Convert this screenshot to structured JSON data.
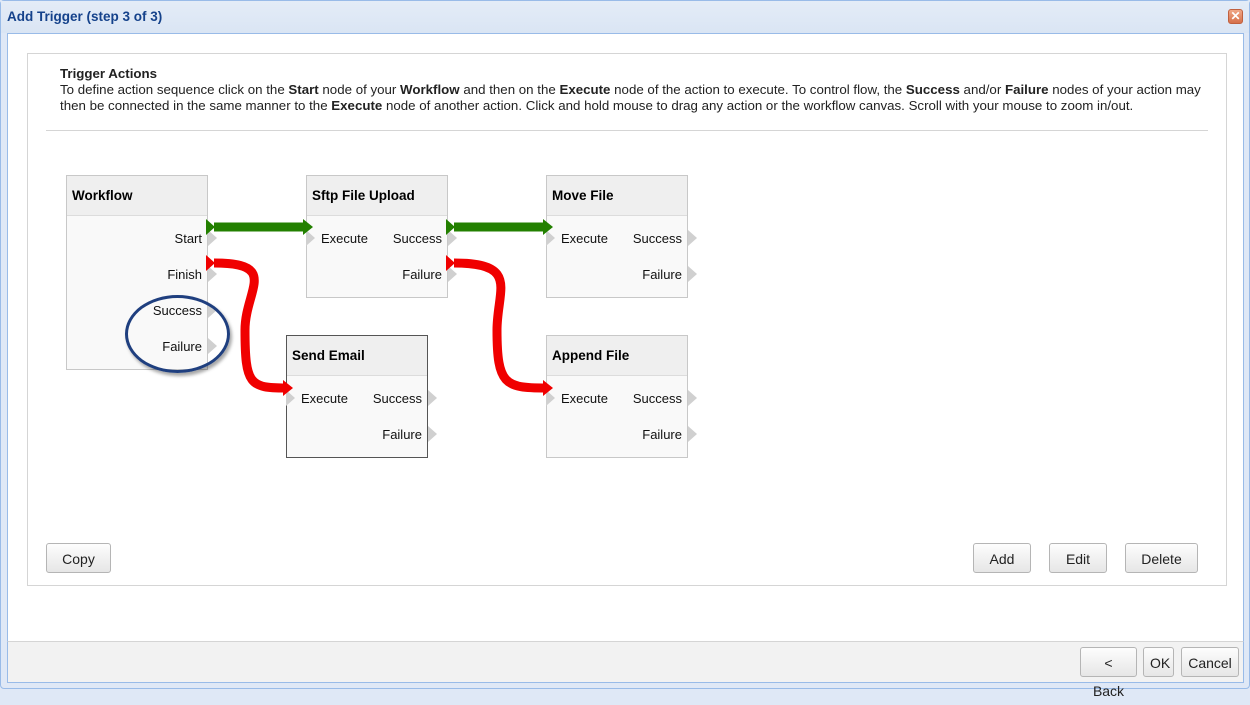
{
  "window": {
    "title": "Add Trigger (step 3 of 3)",
    "close_icon": "close-icon",
    "close_glyph": "✕"
  },
  "instructions": {
    "title": "Trigger Actions",
    "segments": [
      {
        "text": "To define action sequence click on the ",
        "bold": false
      },
      {
        "text": "Start",
        "bold": true
      },
      {
        "text": " node of your ",
        "bold": false
      },
      {
        "text": "Workflow",
        "bold": true
      },
      {
        "text": " and then on the ",
        "bold": false
      },
      {
        "text": "Execute",
        "bold": true
      },
      {
        "text": " node of the action to execute. To control flow, the ",
        "bold": false
      },
      {
        "text": "Success",
        "bold": true
      },
      {
        "text": " and/or ",
        "bold": false
      },
      {
        "text": "Failure",
        "bold": true
      },
      {
        "text": " nodes of your action may then be connected in the same manner to the ",
        "bold": false
      },
      {
        "text": "Execute",
        "bold": true
      },
      {
        "text": " node of another action. Click and hold mouse to drag any action or the workflow canvas. Scroll with your mouse to zoom in/out.",
        "bold": false
      }
    ]
  },
  "colors": {
    "success_wire": "#238000",
    "failure_wire": "#f00000",
    "highlight_ellipse": "#1f3f7f",
    "title_text": "#15428b"
  },
  "nodes": {
    "workflow": {
      "title": "Workflow",
      "outputs": [
        "Start",
        "Finish",
        "Success",
        "Failure"
      ]
    },
    "sftp_upload": {
      "title": "Sftp File Upload",
      "input": "Execute",
      "outputs": [
        "Success",
        "Failure"
      ]
    },
    "move_file": {
      "title": "Move File",
      "input": "Execute",
      "outputs": [
        "Success",
        "Failure"
      ]
    },
    "send_email": {
      "title": "Send Email",
      "input": "Execute",
      "outputs": [
        "Success",
        "Failure"
      ],
      "selected": true
    },
    "append_file": {
      "title": "Append File",
      "input": "Execute",
      "outputs": [
        "Success",
        "Failure"
      ]
    }
  },
  "connections": [
    {
      "from": "Workflow.Start",
      "to": "Sftp File Upload.Execute",
      "type": "success"
    },
    {
      "from": "Workflow.Finish",
      "to": "Send Email.Execute",
      "type": "failure"
    },
    {
      "from": "Sftp File Upload.Success",
      "to": "Move File.Execute",
      "type": "success"
    },
    {
      "from": "Sftp File Upload.Failure",
      "to": "Append File.Execute",
      "type": "failure"
    }
  ],
  "panel_buttons": {
    "copy": "Copy",
    "add": "Add",
    "edit": "Edit",
    "delete": "Delete"
  },
  "footer_buttons": {
    "back": "< Back",
    "ok": "OK",
    "cancel": "Cancel"
  }
}
